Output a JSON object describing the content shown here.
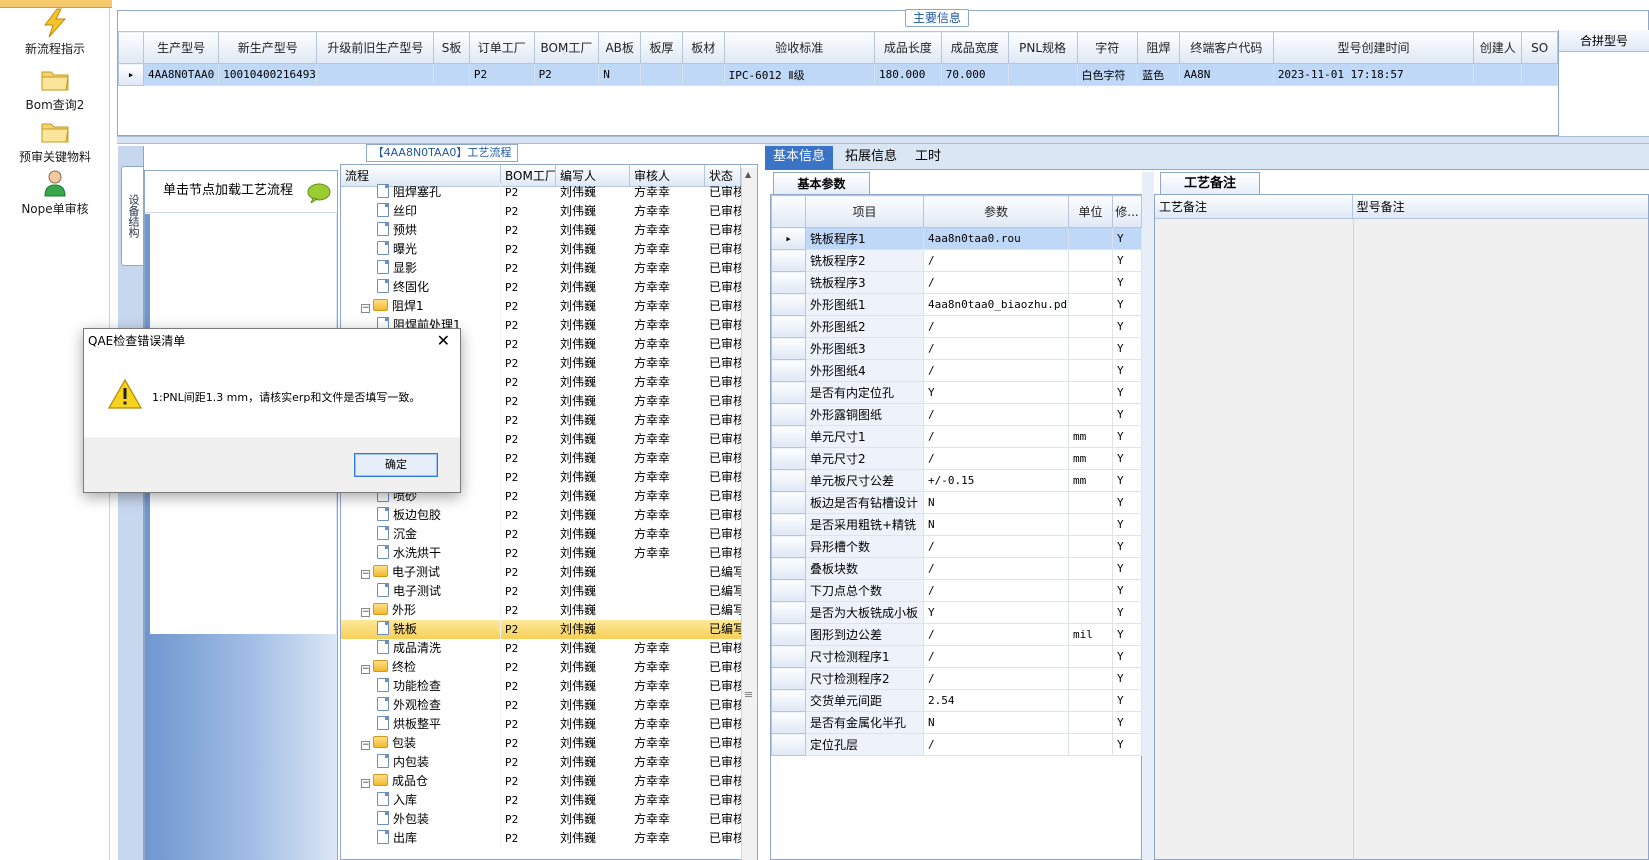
{
  "launcher": {
    "items": [
      {
        "label": "新流程指示",
        "icon": "lightning-icon"
      },
      {
        "label": "Bom查询2",
        "icon": "folder-icon"
      },
      {
        "label": "预审关键物料",
        "icon": "folder-icon"
      },
      {
        "label": "Nope单审核",
        "icon": "user-icon"
      }
    ]
  },
  "main_info": {
    "title": "主要信息",
    "merge_header": "合拼型号",
    "columns": [
      "生产型号",
      "新生产型号",
      "升级前旧生产型号",
      "S板",
      "订单工厂",
      "BOM工厂",
      "AB板",
      "板厚",
      "板材",
      "验收标准",
      "成品长度",
      "成品宽度",
      "PNL规格",
      "字符",
      "阻焊",
      "终端客户代码",
      "型号创建时间",
      "创建人",
      "SO"
    ],
    "row": [
      "4AA8N0TAA0",
      "10010400216493",
      "",
      "",
      "P2",
      "P2",
      "N",
      "",
      "",
      "IPC-6012 Ⅱ级",
      "180.000",
      "70.000",
      "",
      "白色字符",
      "蓝色",
      "AA8N",
      "2023-11-01 17:18:57",
      "",
      ""
    ]
  },
  "node_panel": {
    "side_tab": "设备结构",
    "header": "单击节点加载工艺流程"
  },
  "process": {
    "title": "【4AA8N0TAA0】工艺流程",
    "columns": [
      "流程",
      "BOM工厂",
      "编写人",
      "审核人",
      "状态"
    ],
    "rows": [
      {
        "name": "阻焊塞孔",
        "type": "doc",
        "level": 2,
        "bom": "P2",
        "writer": "刘伟巍",
        "reviewer": "方幸幸",
        "status": "已审核"
      },
      {
        "name": "丝印",
        "type": "doc",
        "level": 2,
        "bom": "P2",
        "writer": "刘伟巍",
        "reviewer": "方幸幸",
        "status": "已审核"
      },
      {
        "name": "预烘",
        "type": "doc",
        "level": 2,
        "bom": "P2",
        "writer": "刘伟巍",
        "reviewer": "方幸幸",
        "status": "已审核"
      },
      {
        "name": "曝光",
        "type": "doc",
        "level": 2,
        "bom": "P2",
        "writer": "刘伟巍",
        "reviewer": "方幸幸",
        "status": "已审核"
      },
      {
        "name": "显影",
        "type": "doc",
        "level": 2,
        "bom": "P2",
        "writer": "刘伟巍",
        "reviewer": "方幸幸",
        "status": "已审核"
      },
      {
        "name": "终固化",
        "type": "doc",
        "level": 2,
        "bom": "P2",
        "writer": "刘伟巍",
        "reviewer": "方幸幸",
        "status": "已审核"
      },
      {
        "name": "阻焊1",
        "type": "folder",
        "level": 1,
        "bom": "P2",
        "writer": "刘伟巍",
        "reviewer": "方幸幸",
        "status": "已审核"
      },
      {
        "name": "阻焊前处理1",
        "type": "doc",
        "level": 2,
        "bom": "P2",
        "writer": "刘伟巍",
        "reviewer": "方幸幸",
        "status": "已审核"
      },
      {
        "name": "",
        "type": "doc",
        "level": 2,
        "bom": "P2",
        "writer": "刘伟巍",
        "reviewer": "方幸幸",
        "status": "已审核"
      },
      {
        "name": "",
        "type": "doc",
        "level": 2,
        "bom": "P2",
        "writer": "刘伟巍",
        "reviewer": "方幸幸",
        "status": "已审核"
      },
      {
        "name": "",
        "type": "doc",
        "level": 2,
        "bom": "P2",
        "writer": "刘伟巍",
        "reviewer": "方幸幸",
        "status": "已审核"
      },
      {
        "name": "",
        "type": "doc",
        "level": 2,
        "bom": "P2",
        "writer": "刘伟巍",
        "reviewer": "方幸幸",
        "status": "已审核"
      },
      {
        "name": "",
        "type": "doc",
        "level": 2,
        "bom": "P2",
        "writer": "刘伟巍",
        "reviewer": "方幸幸",
        "status": "已审核"
      },
      {
        "name": "",
        "type": "doc",
        "level": 2,
        "bom": "P2",
        "writer": "刘伟巍",
        "reviewer": "方幸幸",
        "status": "已审核"
      },
      {
        "name": "",
        "type": "doc",
        "level": 2,
        "bom": "P2",
        "writer": "刘伟巍",
        "reviewer": "方幸幸",
        "status": "已审核"
      },
      {
        "name": "",
        "type": "doc",
        "level": 2,
        "bom": "P2",
        "writer": "刘伟巍",
        "reviewer": "方幸幸",
        "status": "已审核"
      },
      {
        "name": "喷砂",
        "type": "doc",
        "level": 2,
        "bom": "P2",
        "writer": "刘伟巍",
        "reviewer": "方幸幸",
        "status": "已审核"
      },
      {
        "name": "板边包胶",
        "type": "doc",
        "level": 2,
        "bom": "P2",
        "writer": "刘伟巍",
        "reviewer": "方幸幸",
        "status": "已审核"
      },
      {
        "name": "沉金",
        "type": "doc",
        "level": 2,
        "bom": "P2",
        "writer": "刘伟巍",
        "reviewer": "方幸幸",
        "status": "已审核"
      },
      {
        "name": "水洗烘干",
        "type": "doc",
        "level": 2,
        "bom": "P2",
        "writer": "刘伟巍",
        "reviewer": "方幸幸",
        "status": "已审核"
      },
      {
        "name": "电子测试",
        "type": "folder",
        "level": 1,
        "bom": "P2",
        "writer": "刘伟巍",
        "reviewer": "",
        "status": "已编写"
      },
      {
        "name": "电子测试",
        "type": "doc",
        "level": 2,
        "bom": "P2",
        "writer": "刘伟巍",
        "reviewer": "",
        "status": "已编写"
      },
      {
        "name": "外形",
        "type": "folder",
        "level": 1,
        "bom": "P2",
        "writer": "刘伟巍",
        "reviewer": "",
        "status": "已编写"
      },
      {
        "name": "铣板",
        "type": "doc",
        "level": 2,
        "bom": "P2",
        "writer": "刘伟巍",
        "reviewer": "",
        "status": "已编写",
        "selected": true
      },
      {
        "name": "成品清洗",
        "type": "doc",
        "level": 2,
        "bom": "P2",
        "writer": "刘伟巍",
        "reviewer": "方幸幸",
        "status": "已审核"
      },
      {
        "name": "终检",
        "type": "folder",
        "level": 1,
        "bom": "P2",
        "writer": "刘伟巍",
        "reviewer": "方幸幸",
        "status": "已审核"
      },
      {
        "name": "功能检查",
        "type": "doc",
        "level": 2,
        "bom": "P2",
        "writer": "刘伟巍",
        "reviewer": "方幸幸",
        "status": "已审核"
      },
      {
        "name": "外观检查",
        "type": "doc",
        "level": 2,
        "bom": "P2",
        "writer": "刘伟巍",
        "reviewer": "方幸幸",
        "status": "已审核"
      },
      {
        "name": "烘板整平",
        "type": "doc",
        "level": 2,
        "bom": "P2",
        "writer": "刘伟巍",
        "reviewer": "方幸幸",
        "status": "已审核"
      },
      {
        "name": "包装",
        "type": "folder",
        "level": 1,
        "bom": "P2",
        "writer": "刘伟巍",
        "reviewer": "方幸幸",
        "status": "已审核"
      },
      {
        "name": "内包装",
        "type": "doc",
        "level": 2,
        "bom": "P2",
        "writer": "刘伟巍",
        "reviewer": "方幸幸",
        "status": "已审核"
      },
      {
        "name": "成品仓",
        "type": "folder",
        "level": 1,
        "bom": "P2",
        "writer": "刘伟巍",
        "reviewer": "方幸幸",
        "status": "已审核"
      },
      {
        "name": "入库",
        "type": "doc",
        "level": 2,
        "bom": "P2",
        "writer": "刘伟巍",
        "reviewer": "方幸幸",
        "status": "已审核"
      },
      {
        "name": "外包装",
        "type": "doc",
        "level": 2,
        "bom": "P2",
        "writer": "刘伟巍",
        "reviewer": "方幸幸",
        "status": "已审核"
      },
      {
        "name": "出库",
        "type": "doc",
        "level": 2,
        "bom": "P2",
        "writer": "刘伟巍",
        "reviewer": "方幸幸",
        "status": "已审核"
      }
    ]
  },
  "right_tabs": [
    "基本信息",
    "拓展信息",
    "工时"
  ],
  "basic_params": {
    "tab": "基本参数",
    "columns": [
      "项目",
      "参数",
      "单位",
      "修..."
    ],
    "rows": [
      {
        "item": "铣板程序1",
        "value": "4aa8n0taa0.rou",
        "unit": "",
        "mod": "Y",
        "selected": true
      },
      {
        "item": "铣板程序2",
        "value": "/",
        "unit": "",
        "mod": "Y"
      },
      {
        "item": "铣板程序3",
        "value": "/",
        "unit": "",
        "mod": "Y"
      },
      {
        "item": "外形图纸1",
        "value": "4aa8n0taa0_biaozhu.pdf",
        "unit": "",
        "mod": "Y"
      },
      {
        "item": "外形图纸2",
        "value": "/",
        "unit": "",
        "mod": "Y"
      },
      {
        "item": "外形图纸3",
        "value": "/",
        "unit": "",
        "mod": "Y"
      },
      {
        "item": "外形图纸4",
        "value": "/",
        "unit": "",
        "mod": "Y"
      },
      {
        "item": "是否有内定位孔",
        "value": "Y",
        "unit": "",
        "mod": "Y"
      },
      {
        "item": "外形露铜图纸",
        "value": "/",
        "unit": "",
        "mod": "Y"
      },
      {
        "item": "单元尺寸1",
        "value": "/",
        "unit": "mm",
        "mod": "Y"
      },
      {
        "item": "单元尺寸2",
        "value": "/",
        "unit": "mm",
        "mod": "Y"
      },
      {
        "item": "单元板尺寸公差",
        "value": "+/-0.15",
        "unit": "mm",
        "mod": "Y"
      },
      {
        "item": "板边是否有钻槽设计",
        "value": "N",
        "unit": "",
        "mod": "Y"
      },
      {
        "item": "是否采用粗铣+精铣",
        "value": "N",
        "unit": "",
        "mod": "Y"
      },
      {
        "item": "异形槽个数",
        "value": "/",
        "unit": "",
        "mod": "Y"
      },
      {
        "item": "叠板块数",
        "value": "/",
        "unit": "",
        "mod": "Y"
      },
      {
        "item": "下刀点总个数",
        "value": "/",
        "unit": "",
        "mod": "Y"
      },
      {
        "item": "是否为大板铣成小板",
        "value": "Y",
        "unit": "",
        "mod": "Y"
      },
      {
        "item": "图形到边公差",
        "value": "/",
        "unit": "mil",
        "mod": "Y"
      },
      {
        "item": "尺寸检测程序1",
        "value": "/",
        "unit": "",
        "mod": "Y"
      },
      {
        "item": "尺寸检测程序2",
        "value": "/",
        "unit": "",
        "mod": "Y"
      },
      {
        "item": "交货单元间距",
        "value": "2.54",
        "unit": "",
        "mod": "Y"
      },
      {
        "item": "是否有金属化半孔",
        "value": "N",
        "unit": "",
        "mod": "Y"
      },
      {
        "item": "定位孔层",
        "value": "/",
        "unit": "",
        "mod": "Y"
      }
    ]
  },
  "remarks": {
    "tab": "工艺备注",
    "columns": [
      "工艺备注",
      "型号备注"
    ]
  },
  "dialog": {
    "title": "QAE检查错误清单",
    "message": "1:PNL间距1.3 mm，请核实erp和文件是否填写一致。",
    "ok_label": "确定",
    "icon": "warning-icon"
  }
}
